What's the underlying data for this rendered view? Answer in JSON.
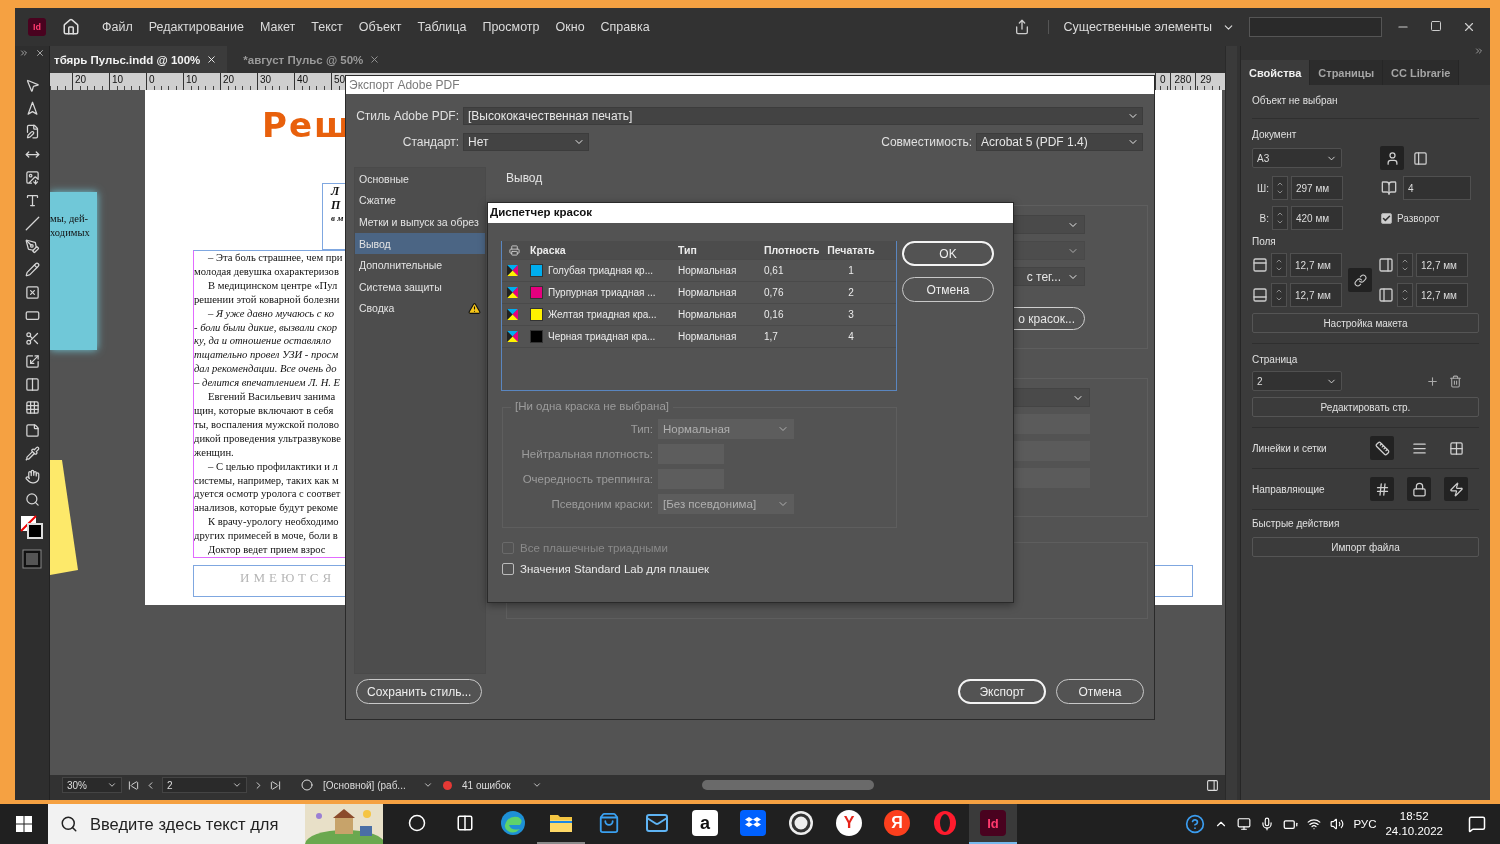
{
  "app": {
    "logo": "Id",
    "menu": [
      "Файл",
      "Редактирование",
      "Макет",
      "Текст",
      "Объект",
      "Таблица",
      "Просмотр",
      "Окно",
      "Справка"
    ],
    "workspace": "Существенные элементы"
  },
  "document_tabs": [
    {
      "label": "тбярь Пульс.indd @ 100%",
      "selected": true
    },
    {
      "label": "*август Пульс @ 50%",
      "selected": false
    }
  ],
  "ruler": {
    "ticks": [
      "20",
      "10",
      "0",
      "10",
      "20",
      "30",
      "40",
      "50"
    ],
    "right_ticks": [
      "0",
      "280",
      "29"
    ]
  },
  "pasteboard": {
    "lines": [
      "мы, дей-",
      "ходимых"
    ]
  },
  "page": {
    "headline": "Реш",
    "subhead": [
      "Л",
      "П",
      "в м"
    ],
    "footer": "ИМЕЮТСЯ",
    "lines": [
      {
        "text": "– Эта боль страшнее, чем при",
        "indent": true,
        "italic": false
      },
      {
        "text": "молодая девушка охарактеризов",
        "indent": false,
        "italic": false
      },
      {
        "text": "В медицинском центре «Пул",
        "indent": true,
        "italic": false
      },
      {
        "text": "решении этой коварной болезни",
        "indent": false,
        "italic": false
      },
      {
        "text": "– Я уже давно мучаюсь с ко",
        "indent": true,
        "italic": true
      },
      {
        "text": "- боли были дикие, вызвали скор",
        "indent": false,
        "italic": true
      },
      {
        "text": "ку, да и отношение оставляло",
        "indent": false,
        "italic": true
      },
      {
        "text": "тщательно провел УЗИ - просм",
        "indent": false,
        "italic": true
      },
      {
        "text": "дал рекомендации. Все очень до",
        "indent": false,
        "italic": true
      },
      {
        "text": "– делится впечатлением Л. Н. Е",
        "indent": false,
        "italic": true
      },
      {
        "text": "Евгений Васильевич занима",
        "indent": true,
        "italic": false
      },
      {
        "text": "щин, которые включают в себя",
        "indent": false,
        "italic": false
      },
      {
        "text": "ты, воспаления мужской полово",
        "indent": false,
        "italic": false
      },
      {
        "text": "дикой проведения ультразвукове",
        "indent": false,
        "italic": false
      },
      {
        "text": "женщин.",
        "indent": false,
        "italic": false
      },
      {
        "text": "– С целью профилактики и л",
        "indent": true,
        "italic": false
      },
      {
        "text": "системы, например, таких как м",
        "indent": false,
        "italic": false
      },
      {
        "text": "дуется осмотр уролога с соответ",
        "indent": false,
        "italic": false
      },
      {
        "text": "анализов, которые будут рекоме",
        "indent": false,
        "italic": false
      },
      {
        "text": "К врачу-урологу необходимо",
        "indent": true,
        "italic": false
      },
      {
        "text": "других примесей в моче, боли в",
        "indent": false,
        "italic": false
      },
      {
        "text": "Доктор ведет прием взрос",
        "indent": true,
        "italic": false
      }
    ]
  },
  "status_bar": {
    "zoom": "30%",
    "page": "2",
    "master": "[Основной] (раб...",
    "errors": "41 ошибок"
  },
  "properties": {
    "tabs": [
      {
        "label": "Свойства",
        "selected": true
      },
      {
        "label": "Страницы",
        "selected": false
      },
      {
        "label": "CC Librarie",
        "selected": false
      }
    ],
    "selection": "Объект не выбран",
    "document": {
      "title": "Документ",
      "preset": "A3",
      "orientation": [
        {
          "kind": "portrait",
          "selected": true
        },
        {
          "kind": "landscape",
          "selected": false
        }
      ],
      "width_label": "Ш:",
      "width": "297 мм",
      "height_label": "В:",
      "height": "420 мм",
      "pages": "4",
      "facing": {
        "label": "Разворот",
        "checked": true
      }
    },
    "margins": {
      "title": "Поля",
      "values": [
        "12,7 мм",
        "12,7 мм",
        "12,7 мм",
        "12,7 мм"
      ]
    },
    "layout_button": "Настройка макета",
    "page": {
      "title": "Страница",
      "value": "2",
      "edit_button": "Редактировать стр."
    },
    "rulers": {
      "title": "Линейки и сетки",
      "buttons": [
        {
          "kind": "rulers",
          "selected": true
        },
        {
          "kind": "baseline",
          "selected": false
        },
        {
          "kind": "grid",
          "selected": false
        }
      ]
    },
    "guides": {
      "title": "Направляющие",
      "buttons": [
        {
          "kind": "guides",
          "selected": true
        },
        {
          "kind": "lock",
          "selected": true
        },
        {
          "kind": "smart",
          "selected": true
        }
      ]
    },
    "quick": {
      "title": "Быстрые действия",
      "button": "Импорт файла"
    }
  },
  "export_dialog": {
    "title": "Экспорт Adobe PDF",
    "preset_label": "Стиль Adobe PDF:",
    "preset": "[Высококачественная печать]",
    "standard_label": "Стандарт:",
    "standard": "Нет",
    "compat_label": "Совместимость:",
    "compat": "Acrobat 5 (PDF 1.4)",
    "nav": [
      {
        "label": "Основные",
        "selected": false,
        "warning": false
      },
      {
        "label": "Сжатие",
        "selected": false,
        "warning": false
      },
      {
        "label": "Метки и выпуск за обрез",
        "selected": false,
        "warning": false
      },
      {
        "label": "Вывод",
        "selected": true,
        "warning": false
      },
      {
        "label": "Дополнительные",
        "selected": false,
        "warning": false
      },
      {
        "label": "Система защиты",
        "selected": false,
        "warning": false
      },
      {
        "label": "Сводка",
        "selected": false,
        "warning": true
      }
    ],
    "section": "Вывод",
    "profile_fragment": "с тег...",
    "ink_button_fragment": "о красок...",
    "save_button": "Сохранить стиль...",
    "buttons": [
      {
        "label": "Экспорт",
        "default": true
      },
      {
        "label": "Отмена",
        "default": false
      }
    ]
  },
  "ink_manager": {
    "title": "Диспетчер красок",
    "columns": [
      "Краска",
      "Тип",
      "Плотность",
      "Печатать"
    ],
    "inks": [
      {
        "name": "Голубая триадная кр...",
        "type": "Нормальная",
        "density": "0,61",
        "order": "1",
        "color": "#00aeef"
      },
      {
        "name": "Пурпурная триадная ...",
        "type": "Нормальная",
        "density": "0,76",
        "order": "2",
        "color": "#e6007e"
      },
      {
        "name": "Желтая триадная кра...",
        "type": "Нормальная",
        "density": "0,16",
        "order": "3",
        "color": "#fff200"
      },
      {
        "name": "Черная триадная кра...",
        "type": "Нормальная",
        "density": "1,7",
        "order": "4",
        "color": "#000000"
      }
    ],
    "buttons": [
      {
        "label": "OK",
        "default": true
      },
      {
        "label": "Отмена",
        "default": false
      }
    ],
    "group": "[Ни одна краска не выбрана]",
    "group_disabled": true,
    "type_label": "Тип:",
    "type": "Нормальная",
    "density_label": "Нейтральная плотность:",
    "trap_label": "Очередность треппинга:",
    "alias_label": "Псевдоним краски:",
    "alias": "[Без псевдонима]",
    "options": [
      {
        "label": "Все плашечные триадными",
        "checked": false,
        "disabled": true
      },
      {
        "label": "Значения Standard Lab для плашек",
        "checked": false,
        "disabled": false
      }
    ]
  },
  "taskbar": {
    "search_placeholder": "Введите здесь текст для",
    "apps": [
      {
        "kind": "cortana",
        "running": false,
        "selected": false
      },
      {
        "kind": "taskview",
        "running": false,
        "selected": false
      },
      {
        "kind": "edge",
        "running": false,
        "selected": false
      },
      {
        "kind": "folder",
        "running": true,
        "selected": false
      },
      {
        "kind": "store",
        "running": false,
        "selected": false
      },
      {
        "kind": "mail",
        "running": false,
        "selected": false
      },
      {
        "kind": "amazon",
        "glyph": "a",
        "running": false,
        "selected": false
      },
      {
        "kind": "dropbox",
        "running": false,
        "selected": false
      },
      {
        "kind": "ring",
        "running": false,
        "selected": false
      },
      {
        "kind": "ybrowser",
        "glyph": "Y",
        "running": false,
        "selected": false
      },
      {
        "kind": "yandex",
        "glyph": "Я",
        "running": false,
        "selected": false
      },
      {
        "kind": "opera",
        "running": false,
        "selected": false
      },
      {
        "kind": "indesign",
        "glyph": "Id",
        "running": true,
        "selected": true
      }
    ],
    "lang": "РУС",
    "time": "18:52",
    "date": "24.10.2022"
  }
}
